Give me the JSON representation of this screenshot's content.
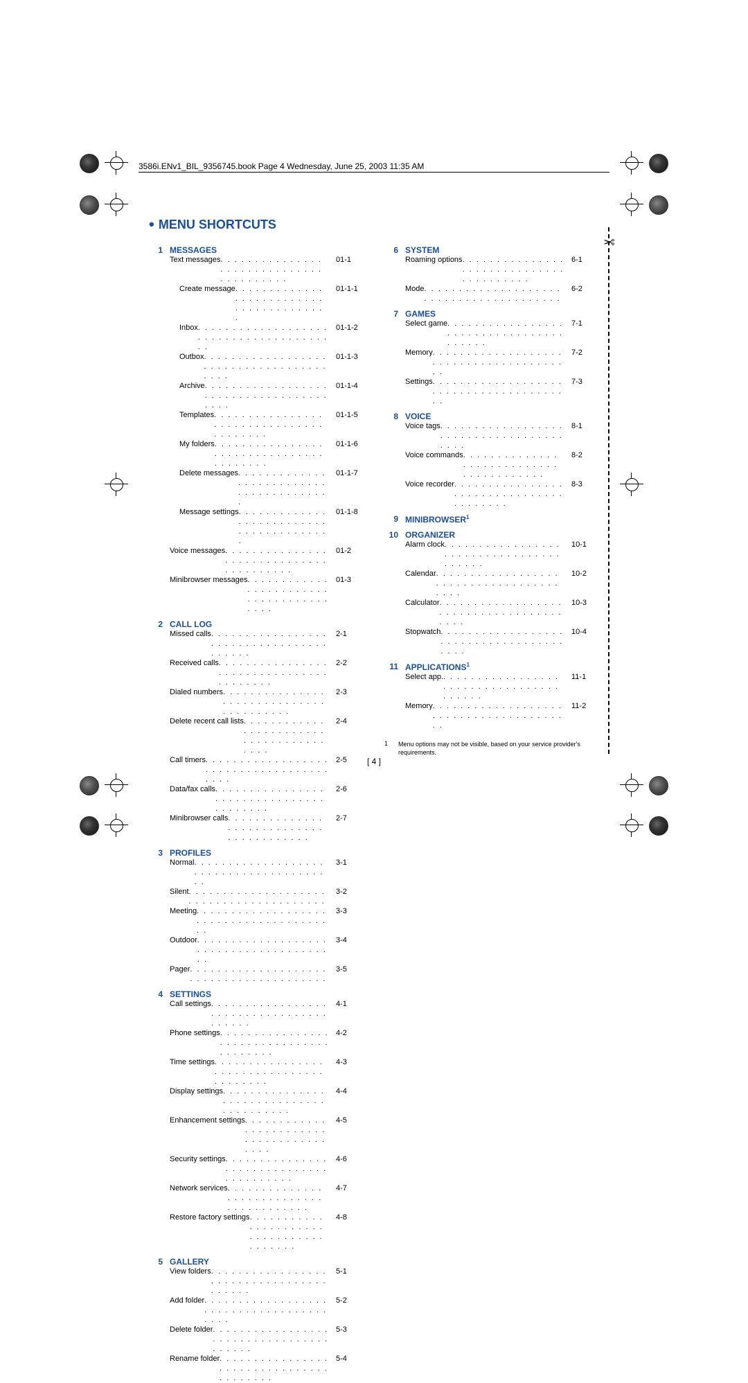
{
  "header_text": "3586i.ENv1_BIL_9356745.book  Page 4  Wednesday, June 25, 2003  11:35 AM",
  "title": "Menu shortcuts",
  "page_number": "[ 4 ]",
  "footnote": {
    "num": "1",
    "text": "Menu options may not be visible, based on your service provider's requirements."
  },
  "left_sections": [
    {
      "num": "1",
      "title": "MESSAGES",
      "sup": "",
      "items": [
        {
          "label": "Text messages",
          "code": "01-1",
          "indent": 0
        },
        {
          "label": "Create message",
          "code": "01-1-1",
          "indent": 1
        },
        {
          "label": "Inbox",
          "code": "01-1-2",
          "indent": 1
        },
        {
          "label": "Outbox",
          "code": "01-1-3",
          "indent": 1
        },
        {
          "label": "Archive",
          "code": "01-1-4",
          "indent": 1
        },
        {
          "label": "Templates",
          "code": "01-1-5",
          "indent": 1
        },
        {
          "label": "My folders",
          "code": "01-1-6",
          "indent": 1
        },
        {
          "label": "Delete messages",
          "code": "01-1-7",
          "indent": 1
        },
        {
          "label": "Message settings",
          "code": "01-1-8",
          "indent": 1
        },
        {
          "label": "Voice messages",
          "code": "01-2",
          "indent": 0
        },
        {
          "label": "Minibrowser messages",
          "code": "01-3",
          "indent": 0
        }
      ]
    },
    {
      "num": "2",
      "title": "CALL LOG",
      "sup": "",
      "items": [
        {
          "label": "Missed calls",
          "code": "2-1",
          "indent": 0
        },
        {
          "label": "Received calls",
          "code": "2-2",
          "indent": 0
        },
        {
          "label": "Dialed numbers",
          "code": "2-3",
          "indent": 0
        },
        {
          "label": "Delete recent call lists",
          "code": "2-4",
          "indent": 0
        },
        {
          "label": "Call timers",
          "code": "2-5",
          "indent": 0
        },
        {
          "label": "Data/fax calls",
          "code": "2-6",
          "indent": 0
        },
        {
          "label": "Minibrowser calls",
          "code": "2-7",
          "indent": 0
        }
      ]
    },
    {
      "num": "3",
      "title": "PROFILES",
      "sup": "",
      "items": [
        {
          "label": "Normal",
          "code": "3-1",
          "indent": 0
        },
        {
          "label": "Silent",
          "code": "3-2",
          "indent": 0
        },
        {
          "label": "Meeting",
          "code": "3-3",
          "indent": 0
        },
        {
          "label": "Outdoor",
          "code": "3-4",
          "indent": 0
        },
        {
          "label": "Pager",
          "code": "3-5",
          "indent": 0
        }
      ]
    },
    {
      "num": "4",
      "title": "SETTINGS",
      "sup": "",
      "items": [
        {
          "label": "Call settings",
          "code": "4-1",
          "indent": 0
        },
        {
          "label": "Phone settings",
          "code": "4-2",
          "indent": 0
        },
        {
          "label": "Time settings",
          "code": "4-3",
          "indent": 0
        },
        {
          "label": "Display settings",
          "code": "4-4",
          "indent": 0
        },
        {
          "label": "Enhancement settings",
          "code": "4-5",
          "indent": 0
        },
        {
          "label": "Security settings",
          "code": "4-6",
          "indent": 0
        },
        {
          "label": "Network services",
          "code": "4-7",
          "indent": 0
        },
        {
          "label": "Restore factory settings",
          "code": "4-8",
          "indent": 0
        }
      ]
    },
    {
      "num": "5",
      "title": "GALLERY",
      "sup": "",
      "items": [
        {
          "label": "View folders",
          "code": "5-1",
          "indent": 0
        },
        {
          "label": "Add folder",
          "code": "5-2",
          "indent": 0
        },
        {
          "label": "Delete folder",
          "code": "5-3",
          "indent": 0
        },
        {
          "label": "Rename folder",
          "code": "5-4",
          "indent": 0
        }
      ]
    }
  ],
  "right_sections": [
    {
      "num": "6",
      "title": "SYSTEM",
      "sup": "",
      "items": [
        {
          "label": "Roaming options",
          "code": "6-1",
          "indent": 0
        },
        {
          "label": "Mode",
          "code": "6-2",
          "indent": 0
        }
      ]
    },
    {
      "num": "7",
      "title": "GAMES",
      "sup": "",
      "items": [
        {
          "label": "Select game",
          "code": "7-1",
          "indent": 0
        },
        {
          "label": "Memory",
          "code": "7-2",
          "indent": 0
        },
        {
          "label": "Settings",
          "code": "7-3",
          "indent": 0
        }
      ]
    },
    {
      "num": "8",
      "title": "VOICE",
      "sup": "",
      "items": [
        {
          "label": "Voice tags",
          "code": "8-1",
          "indent": 0
        },
        {
          "label": "Voice commands",
          "code": "8-2",
          "indent": 0
        },
        {
          "label": "Voice recorder",
          "code": "8-3",
          "indent": 0
        }
      ]
    },
    {
      "num": "9",
      "title": "MINIBROWSER",
      "sup": "1",
      "items": []
    },
    {
      "num": "10",
      "title": "ORGANIZER",
      "sup": "",
      "items": [
        {
          "label": "Alarm clock",
          "code": "10-1",
          "indent": 0
        },
        {
          "label": "Calendar",
          "code": "10-2",
          "indent": 0
        },
        {
          "label": "Calculator",
          "code": "10-3",
          "indent": 0
        },
        {
          "label": "Stopwatch",
          "code": "10-4",
          "indent": 0
        }
      ]
    },
    {
      "num": "11",
      "title": "APPLICATIONS",
      "sup": "1",
      "items": [
        {
          "label": "Select app.",
          "code": "11-1",
          "indent": 0
        },
        {
          "label": "Memory",
          "code": "11-2",
          "indent": 0
        }
      ]
    }
  ]
}
